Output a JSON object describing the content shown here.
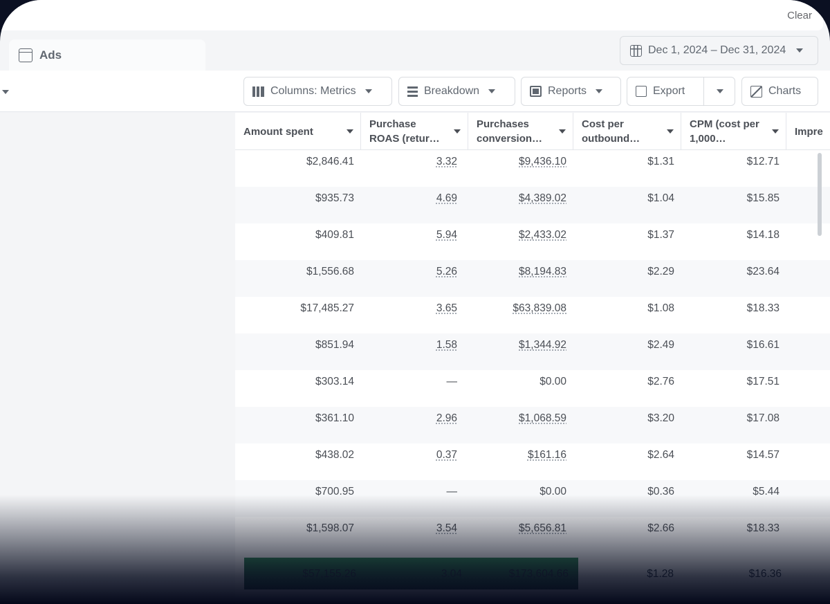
{
  "topbar": {
    "clear": "Clear"
  },
  "tab": {
    "label": "Ads"
  },
  "date_range": {
    "label": "Dec 1, 2024 – Dec 31, 2024"
  },
  "toolbar": {
    "columns": "Columns: Metrics",
    "breakdown": "Breakdown",
    "reports": "Reports",
    "export": "Export",
    "charts": "Charts"
  },
  "table": {
    "headers": [
      [
        "Amount spent",
        ""
      ],
      [
        "Purchase",
        "ROAS (retur…"
      ],
      [
        "Purchases",
        "conversion…"
      ],
      [
        "Cost per",
        "outbound…"
      ],
      [
        "CPM (cost per",
        "1,000…"
      ],
      [
        "Impre",
        ""
      ]
    ],
    "rows": [
      [
        "$2,846.41",
        "3.32",
        "$9,436.10",
        "$1.31",
        "$12.71"
      ],
      [
        "$935.73",
        "4.69",
        "$4,389.02",
        "$1.04",
        "$15.85"
      ],
      [
        "$409.81",
        "5.94",
        "$2,433.02",
        "$1.37",
        "$14.18"
      ],
      [
        "$1,556.68",
        "5.26",
        "$8,194.83",
        "$2.29",
        "$23.64"
      ],
      [
        "$17,485.27",
        "3.65",
        "$63,839.08",
        "$1.08",
        "$18.33"
      ],
      [
        "$851.94",
        "1.58",
        "$1,344.92",
        "$2.49",
        "$16.61"
      ],
      [
        "$303.14",
        "—",
        "$0.00",
        "$2.76",
        "$17.51"
      ],
      [
        "$361.10",
        "2.96",
        "$1,068.59",
        "$3.20",
        "$17.08"
      ],
      [
        "$438.02",
        "0.37",
        "$161.16",
        "$2.64",
        "$14.57"
      ],
      [
        "$700.95",
        "—",
        "$0.00",
        "$0.36",
        "$5.44"
      ],
      [
        "$1,598.07",
        "3.54",
        "$5,656.81",
        "$2.66",
        "$18.33"
      ]
    ],
    "totals": [
      "$57,155.26",
      "3.04",
      "$173,604.66",
      "$1.28",
      "$16.36"
    ]
  }
}
